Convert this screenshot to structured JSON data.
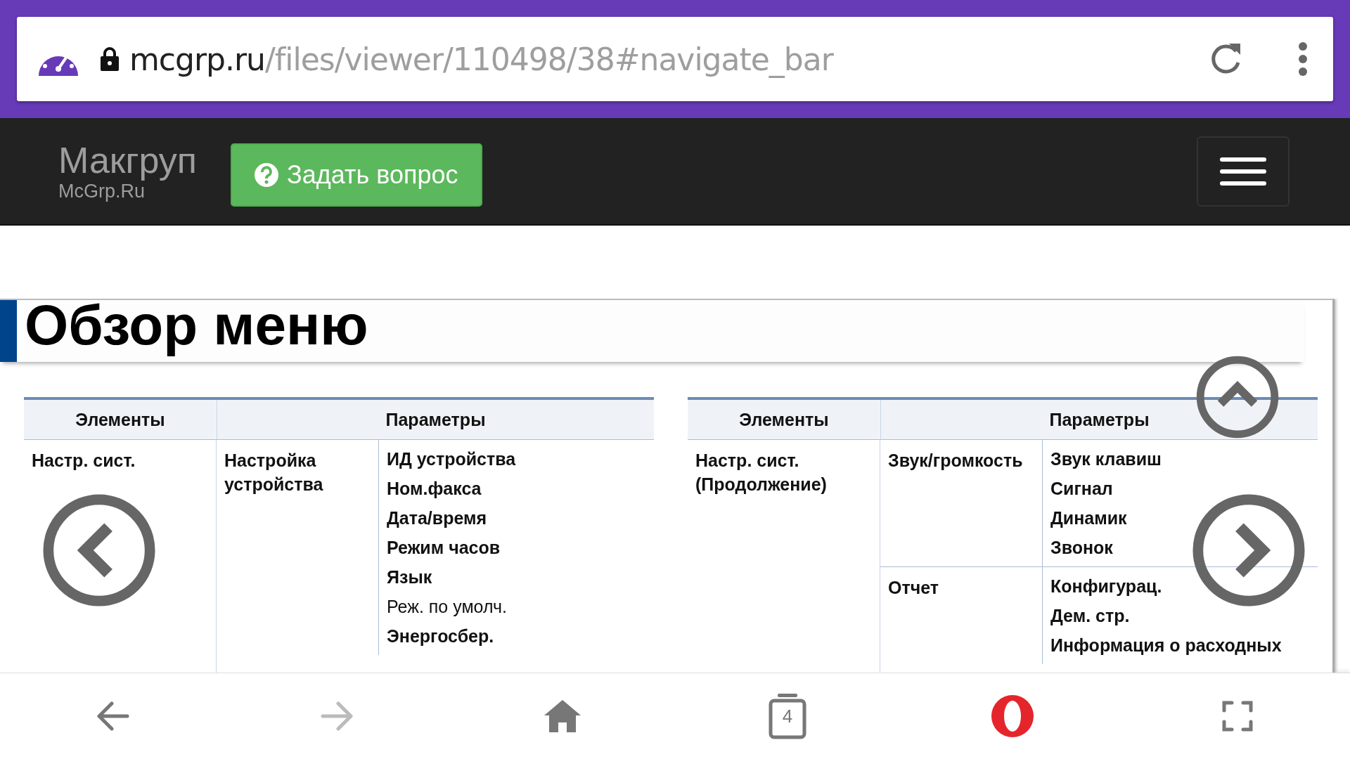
{
  "address_bar": {
    "domain": "mcgrp.ru",
    "path": "/files/viewer/110498/38#navigate_bar"
  },
  "header": {
    "brand": "Макгруп",
    "subtitle": "McGrp.Ru",
    "ask_button": "Задать вопрос"
  },
  "document": {
    "title": "Обзор меню",
    "tables": [
      {
        "columns": [
          "Элементы",
          "Параметры"
        ],
        "element": "Настр. сист.",
        "groups": [
          {
            "name": "Настройка устройства",
            "items": [
              {
                "label": "ИД устройства",
                "bold": true
              },
              {
                "label": "Ном.факса",
                "bold": true
              },
              {
                "label": "Дата/время",
                "bold": true
              },
              {
                "label": "Режим часов",
                "bold": true
              },
              {
                "label": "Язык",
                "bold": true
              },
              {
                "label": "Реж. по умолч.",
                "bold": false
              },
              {
                "label": "Энергосбер.",
                "bold": true
              }
            ]
          }
        ]
      },
      {
        "columns": [
          "Элементы",
          "Параметры"
        ],
        "element": "Настр. сист. (Продолжение)",
        "groups": [
          {
            "name": "Звук/громкость",
            "items": [
              {
                "label": "Звук клавиш",
                "bold": true
              },
              {
                "label": "Сигнал",
                "bold": true
              },
              {
                "label": "Динамик",
                "bold": true
              },
              {
                "label": "Звонок",
                "bold": true
              }
            ]
          },
          {
            "name": "Отчет",
            "items": [
              {
                "label": "Конфигурац.",
                "bold": true
              },
              {
                "label": "Дем. стр.",
                "bold": true
              },
              {
                "label": "Информация о расходных",
                "bold": true
              }
            ]
          }
        ]
      }
    ]
  },
  "bottom_bar": {
    "back_enabled": true,
    "forward_enabled": false,
    "tab_count": "4"
  }
}
